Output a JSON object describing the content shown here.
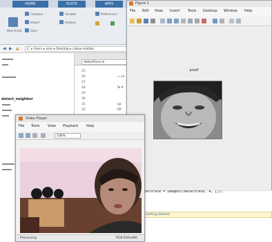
{
  "ide": {
    "tabs": [
      "HOME",
      "PLOTS",
      "APPS"
    ],
    "ribbon_labels": [
      "New Script",
      "Compare",
      "Import",
      "Save",
      "Variable",
      "Analyze",
      "Preferences"
    ],
    "path": "C: ▸ Users ▸ user ▸ Desktop ▸ cvbox-matlab",
    "workspace_label": "detect_neighbor",
    "editor_tab": "detectFace.m",
    "line_numbers": [
      "25",
      "26",
      "27",
      "28",
      "29",
      "30",
      "31",
      "32"
    ],
    "code_snippets": [
      "= cv",
      "% fr",
      "cp",
      "CP"
    ],
    "command_line": "otectFace = imageSc(detectFace, 4, []);",
    "status_link": "Getting Started"
  },
  "figure": {
    "title": "Figure 1",
    "menus": [
      "File",
      "Edit",
      "View",
      "Insert",
      "Tools",
      "Desktop",
      "Window",
      "Help"
    ],
    "caption": "proof"
  },
  "video": {
    "title": "Video Player",
    "menus": [
      "File",
      "Tools",
      "View",
      "Playback",
      "Help"
    ],
    "zoom": "100%",
    "status_left": "Processing",
    "status_right": "RGB:640x480"
  },
  "icons": [
    "matlab-logo-icon",
    "nav-back-icon",
    "nav-forward-icon",
    "zoom-in-icon",
    "zoom-out-icon",
    "pan-icon",
    "rotate-icon",
    "data-cursor-icon",
    "save-icon",
    "print-icon",
    "open-icon"
  ],
  "colors": {
    "accent": "#3b6fa8",
    "status_bg": "#fff6cf",
    "video_bg": "#e8c9d8"
  }
}
